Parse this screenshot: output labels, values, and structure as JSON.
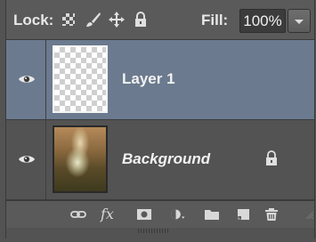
{
  "toprow": {
    "lock_label": "Lock:",
    "fill_label": "Fill:",
    "fill_value": "100%",
    "lock_icons": [
      "lock-transparent-pixels-icon",
      "lock-image-pixels-icon",
      "lock-position-icon",
      "lock-all-icon"
    ]
  },
  "layers": [
    {
      "name": "Layer 1",
      "selected": true,
      "visible": true,
      "locked": false,
      "thumbnail": "transparent"
    },
    {
      "name": "Background",
      "selected": false,
      "visible": true,
      "locked": true,
      "thumbnail": "photo"
    }
  ],
  "toolbar": {
    "fx_label": "fx",
    "icons": [
      "link-layers-icon",
      "layer-style-icon",
      "add-mask-icon",
      "adjustment-layer-icon",
      "new-group-icon",
      "new-layer-icon",
      "delete-layer-icon"
    ]
  },
  "colors": {
    "panel_bg": "#535353",
    "selected_row": "#6b7a8e",
    "text": "#f2f2f2"
  }
}
